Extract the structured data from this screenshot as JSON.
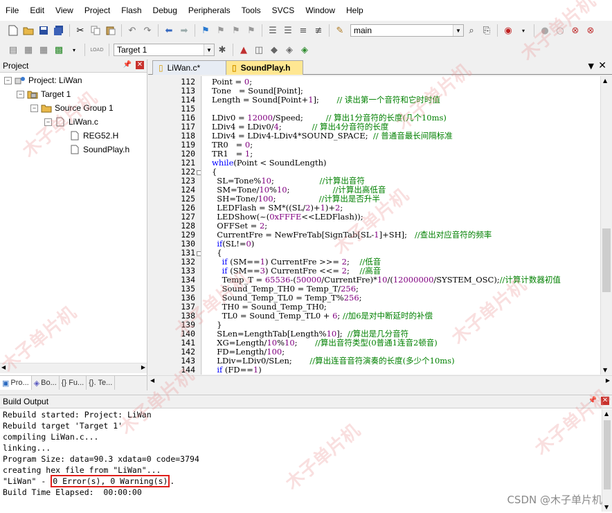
{
  "menu": [
    "File",
    "Edit",
    "View",
    "Project",
    "Flash",
    "Debug",
    "Peripherals",
    "Tools",
    "SVCS",
    "Window",
    "Help"
  ],
  "toolbar": {
    "find_combo_value": "main",
    "target_combo_value": "Target 1",
    "load_label": "LOAD"
  },
  "project_panel": {
    "title": "Project",
    "tree": [
      {
        "label": "Project: LiWan",
        "level": 0,
        "expander": "−",
        "icon": "project-icon"
      },
      {
        "label": "Target 1",
        "level": 1,
        "expander": "−",
        "icon": "target-icon"
      },
      {
        "label": "Source Group 1",
        "level": 2,
        "expander": "−",
        "icon": "folder-icon"
      },
      {
        "label": "LiWan.c",
        "level": 3,
        "expander": "−",
        "icon": "c-file-icon"
      },
      {
        "label": "REG52.H",
        "level": 4,
        "expander": "",
        "icon": "header-file-icon"
      },
      {
        "label": "SoundPlay.h",
        "level": 4,
        "expander": "",
        "icon": "header-file-icon"
      }
    ],
    "tabs": [
      "Pro...",
      "Bo...",
      "{} Fu...",
      "{}. Te..."
    ]
  },
  "editor": {
    "tabs": [
      {
        "label": "LiWan.c*",
        "active": false
      },
      {
        "label": "SoundPlay.h",
        "active": true
      }
    ],
    "lines": [
      {
        "n": "112",
        "text": "Point = 0;"
      },
      {
        "n": "113",
        "text": "Tone   = Sound[Point];"
      },
      {
        "n": "114",
        "text": "Length = Sound[Point+1];       // 读出第一个音符和它时时值"
      },
      {
        "n": "115",
        "text": ""
      },
      {
        "n": "116",
        "text": "LDiv0 = 12000/Speed;         // 算出1分音符的长度(几个10ms)"
      },
      {
        "n": "117",
        "text": "LDiv4 = LDiv0/4;            // 算出4分音符的长度"
      },
      {
        "n": "118",
        "text": "LDiv4 = LDiv4-LDiv4*SOUND_SPACE;  // 普通音最长间隔标准"
      },
      {
        "n": "119",
        "text": "TR0   = 0;"
      },
      {
        "n": "120",
        "text": "TR1   = 1;"
      },
      {
        "n": "121",
        "text": "while(Point < SoundLength)"
      },
      {
        "n": "122",
        "text": "{"
      },
      {
        "n": "123",
        "text": "  SL=Tone%10;                  //计算出音符"
      },
      {
        "n": "124",
        "text": "  SM=Tone/10%10;                 //计算出高低音"
      },
      {
        "n": "125",
        "text": "  SH=Tone/100;                 //计算出是否升半"
      },
      {
        "n": "126",
        "text": "  LEDFlash = SM*((SL/2)+1)+2;"
      },
      {
        "n": "127",
        "text": "  LEDShow(~(0xFFFE<<LEDFlash));"
      },
      {
        "n": "128",
        "text": "  OFFSet = 2;"
      },
      {
        "n": "129",
        "text": "  CurrentFre = NewFreTab[SignTab[SL-1]+SH];   //查出对应音符的频率"
      },
      {
        "n": "130",
        "text": "  if(SL!=0)"
      },
      {
        "n": "131",
        "text": "  {"
      },
      {
        "n": "132",
        "text": "    if (SM==1) CurrentFre >>= 2;    //低音"
      },
      {
        "n": "133",
        "text": "    if (SM==3) CurrentFre <<= 2;    //高音"
      },
      {
        "n": "134",
        "text": "    Temp_T = 65536-(50000/CurrentFre)*10/(12000000/SYSTEM_OSC);//计算计数器初值"
      },
      {
        "n": "135",
        "text": "    Sound_Temp_TH0 = Temp_T/256;"
      },
      {
        "n": "136",
        "text": "    Sound_Temp_TL0 = Temp_T%256;"
      },
      {
        "n": "137",
        "text": "    TH0 = Sound_Temp_TH0;"
      },
      {
        "n": "138",
        "text": "    TL0 = Sound_Temp_TL0 + 6; //加6是对中断延时的补偿"
      },
      {
        "n": "139",
        "text": "  }"
      },
      {
        "n": "140",
        "text": "  SLen=LengthTab[Length%10];  //算出是几分音符"
      },
      {
        "n": "141",
        "text": "  XG=Length/10%10;       //算出音符类型(0普通1连音2顿音)"
      },
      {
        "n": "142",
        "text": "  FD=Length/100;"
      },
      {
        "n": "143",
        "text": "  LDiv=LDiv0/SLen;       //算出连音音符演奏的长度(多少个10ms)"
      },
      {
        "n": "144",
        "text": "  if (FD==1)"
      }
    ]
  },
  "build_output": {
    "title": "Build Output",
    "lines": [
      "Rebuild started: Project: LiWan",
      "Rebuild target 'Target 1'",
      "compiling LiWan.c...",
      "linking...",
      "Program Size: data=90.3 xdata=0 code=3794",
      "creating hex file from \"LiWan\"...",
      "\"LiWan\" - ",
      "Build Time Elapsed:  00:00:00"
    ],
    "result_highlight": "0 Error(s), 0 Warning(s)",
    "result_suffix": "."
  },
  "watermark_text": "木子单片机",
  "footer_credit": "CSDN @木子单片机",
  "colors": {
    "comment": "#008000",
    "number": "#800080",
    "keyword": "#0000ff",
    "error_box": "#e0201c",
    "active_tab": "#ffe792"
  }
}
